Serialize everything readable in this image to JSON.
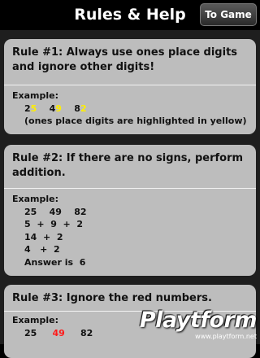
{
  "navbar": {
    "title": "Rules & Help",
    "button_label": "To Game"
  },
  "rules": [
    {
      "title": "Rule #1: Always use ones place digits and ignore other digits!",
      "example_label": "Example:",
      "numbers": [
        {
          "lead": "2",
          "ones": "5"
        },
        {
          "lead": "4",
          "ones": "9"
        },
        {
          "lead": "8",
          "ones": "2"
        }
      ],
      "note": "(ones place digits are highlighted in yellow)"
    },
    {
      "title": "Rule #2: If there are no signs, perform addition.",
      "example_label": "Example:",
      "lines": [
        "25    49    82",
        "5  +  9  +  2",
        "14  +  2",
        "4   +  2",
        "Answer is  6"
      ]
    },
    {
      "title": "Rule #3: Ignore the red numbers.",
      "example_label": "Example:",
      "numbers": [
        "25",
        "49",
        "82"
      ]
    }
  ],
  "watermark": {
    "logo": "Playtform",
    "url": "www.playtform.net"
  },
  "colors": {
    "highlight_yellow": "#ffee00",
    "ignore_red": "#ff1a1a",
    "card_bg": "#bdbdbd"
  }
}
